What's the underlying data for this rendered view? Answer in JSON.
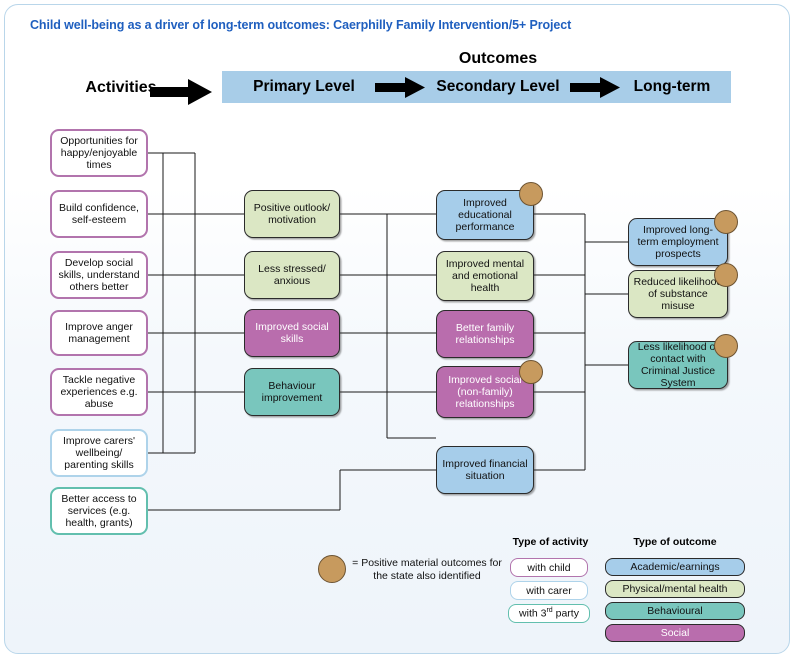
{
  "title": "Child well-being as a driver of long-term outcomes: Caerphilly Family Intervention/5+ Project",
  "header": {
    "outcomes_label": "Outcomes",
    "activities_label": "Activities",
    "levels": [
      "Primary Level",
      "Secondary Level",
      "Long-term"
    ]
  },
  "colors": {
    "title": "#1f5fbf",
    "bar": "#a8cde8",
    "academic": "#a6cdea",
    "health": "#dbe7c4",
    "behavioural": "#79c6bd",
    "social": "#b96dad",
    "dot": "#c79a5e",
    "border_child": "#b274ad",
    "border_carer": "#aed3ea",
    "border_third": "#62bfae"
  },
  "activities": [
    {
      "label": "Opportunities for happy/enjoyable times",
      "type": "with child"
    },
    {
      "label": "Build confidence, self-esteem",
      "type": "with child"
    },
    {
      "label": "Develop social skills, understand others better",
      "type": "with child"
    },
    {
      "label": "Improve anger management",
      "type": "with child"
    },
    {
      "label": "Tackle negative experiences e.g. abuse",
      "type": "with child"
    },
    {
      "label": "Improve carers' wellbeing/ parenting skills",
      "type": "with carer"
    },
    {
      "label": "Better access to services (e.g. health, grants)",
      "type": "with 3rd party"
    }
  ],
  "primary": [
    {
      "label": "Positive outlook/ motivation",
      "type": "Physical/mental health",
      "state_dot": false
    },
    {
      "label": "Less stressed/ anxious",
      "type": "Physical/mental health",
      "state_dot": false
    },
    {
      "label": "Improved social skills",
      "type": "Social",
      "state_dot": false
    },
    {
      "label": "Behaviour improvement",
      "type": "Behavioural",
      "state_dot": false
    }
  ],
  "secondary": [
    {
      "label": "Improved educational performance",
      "type": "Academic/earnings",
      "state_dot": true
    },
    {
      "label": "Improved mental and emotional health",
      "type": "Physical/mental health",
      "state_dot": false
    },
    {
      "label": "Better family relationships",
      "type": "Social",
      "state_dot": false
    },
    {
      "label": "Improved social (non-family) relationships",
      "type": "Social",
      "state_dot": true
    },
    {
      "label": "Improved financial situation",
      "type": "Academic/earnings",
      "state_dot": false
    }
  ],
  "longterm": [
    {
      "label": "Improved long-term employment prospects",
      "type": "Academic/earnings",
      "state_dot": true
    },
    {
      "label": "Reduced likelihood of substance misuse",
      "type": "Physical/mental health",
      "state_dot": true
    },
    {
      "label": "Less likelihood of contact with Criminal Justice System",
      "type": "Behavioural",
      "state_dot": true
    }
  ],
  "legend": {
    "dot_text": "= Positive material outcomes for the state also identified",
    "activity_heading": "Type of activity",
    "activity_items": [
      "with child",
      "with carer",
      "with 3rd party"
    ],
    "outcome_heading": "Type of outcome",
    "outcome_items": [
      "Academic/earnings",
      "Physical/mental health",
      "Behavioural",
      "Social"
    ]
  }
}
